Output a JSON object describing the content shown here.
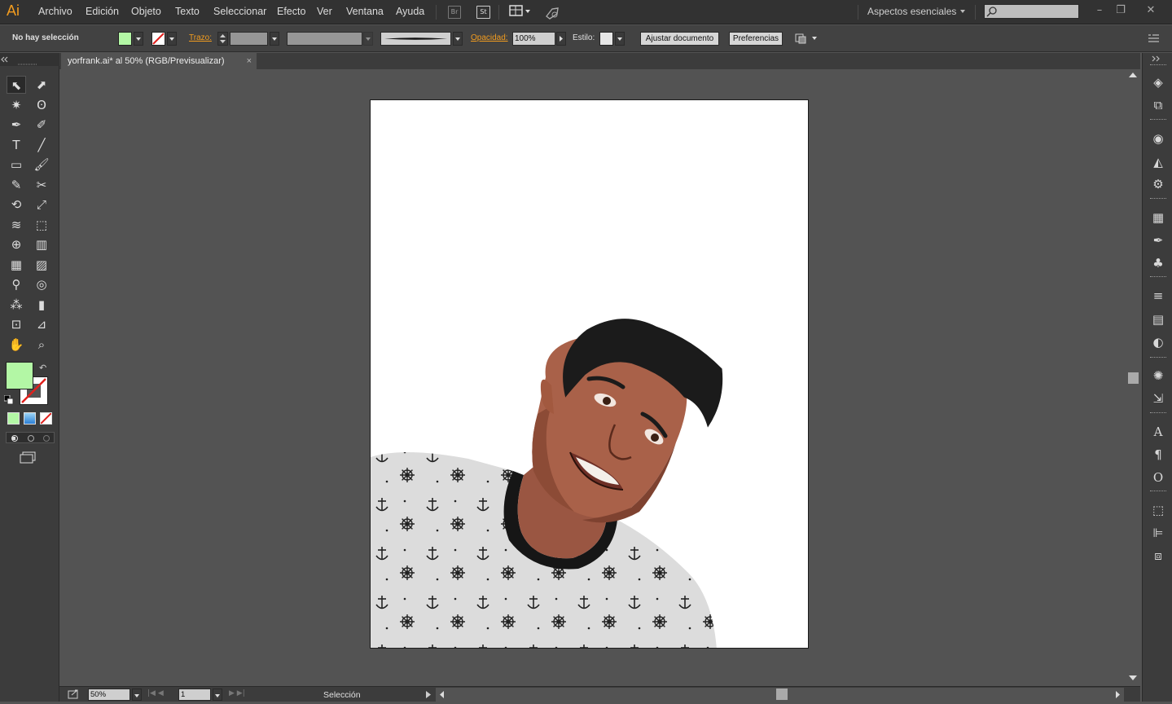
{
  "app": {
    "logo": "Ai"
  },
  "menu": [
    "Archivo",
    "Edición",
    "Objeto",
    "Texto",
    "Seleccionar",
    "Efecto",
    "Ver",
    "Ventana",
    "Ayuda"
  ],
  "menubar_buttons": [
    "Br",
    "St"
  ],
  "workspace": "Aspectos esenciales",
  "control": {
    "selection": "No hay selección",
    "stroke_label": "Trazo:",
    "opacity_label": "Opacidad:",
    "opacity_value": "100%",
    "style_label": "Estilo:",
    "doc_button": "Ajustar documento",
    "prefs_button": "Preferencias"
  },
  "document": {
    "tab_title": "yorfrank.ai* al 50% (RGB/Previsualizar)"
  },
  "status": {
    "zoom": "50%",
    "artboard": "1",
    "tool": "Selección"
  },
  "colors": {
    "fill": "#b3f7a5",
    "accent": "#f29c1f"
  },
  "tools": [
    "selection-tool",
    "direct-selection-tool",
    "magic-wand-tool",
    "lasso-tool",
    "pen-tool",
    "curvature-tool",
    "type-tool",
    "line-tool",
    "rectangle-tool",
    "paintbrush-tool",
    "pencil-tool",
    "scissors-tool",
    "rotate-tool",
    "scale-tool",
    "warp-tool",
    "free-transform-tool",
    "shape-builder-tool",
    "graph-tool",
    "mesh-tool",
    "gradient-tool",
    "eyedropper-tool",
    "blend-tool",
    "symbol-sprayer-tool",
    "column-graph-tool",
    "artboard-tool",
    "slice-tool",
    "hand-tool",
    "zoom-tool"
  ],
  "right_panels": [
    "layers-icon",
    "artboards-icon",
    "color-guide-icon",
    "color-icon",
    "appearance-icon",
    "swatches-icon",
    "brushes-icon",
    "symbols-icon",
    "stroke-icon",
    "gradient-icon",
    "transparency-icon",
    "graphic-styles-icon",
    "export-icon",
    "character-icon",
    "paragraph-icon",
    "opentype-icon",
    "transform-icon",
    "align-icon",
    "pathfinder-icon"
  ]
}
